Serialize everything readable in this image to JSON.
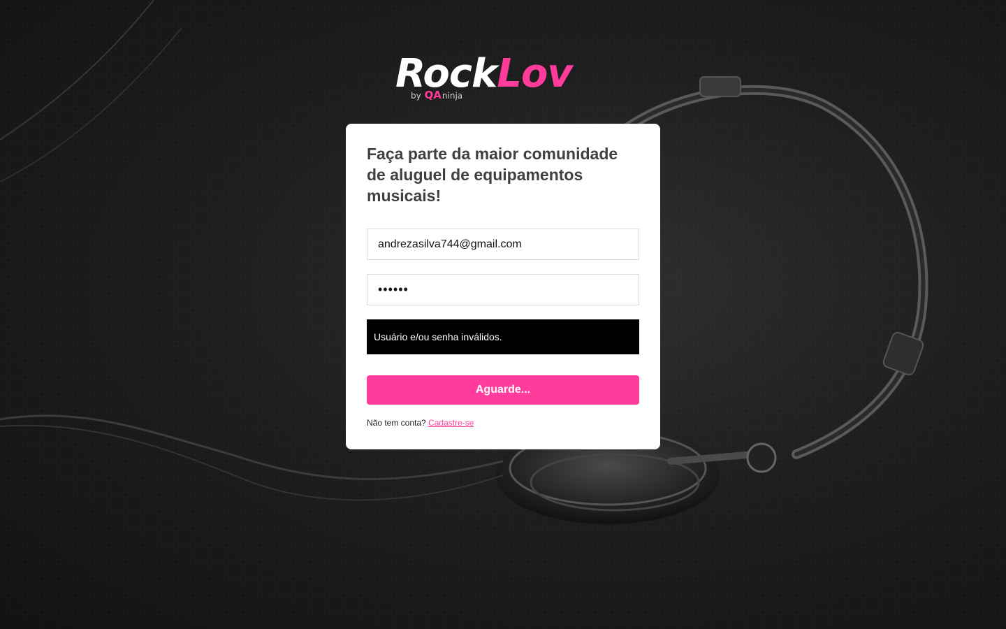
{
  "brand": {
    "name_part1": "Rock",
    "name_part2": "Lov",
    "by_text": "by",
    "qa_text": "QA",
    "ninja_text": "ninja",
    "accent_color": "#ff3c9c"
  },
  "login": {
    "headline": "Faça parte da maior comunidade de aluguel de equipamentos musicais!",
    "email_value": "andrezasilva744@gmail.com",
    "password_value": "••••••",
    "alert_text": "Usuário e/ou senha inválidos.",
    "submit_label": "Aguarde...",
    "signup_prompt": "Não tem conta?",
    "signup_link": "Cadastre-se"
  },
  "background": {
    "icon": "headphones-photo"
  }
}
